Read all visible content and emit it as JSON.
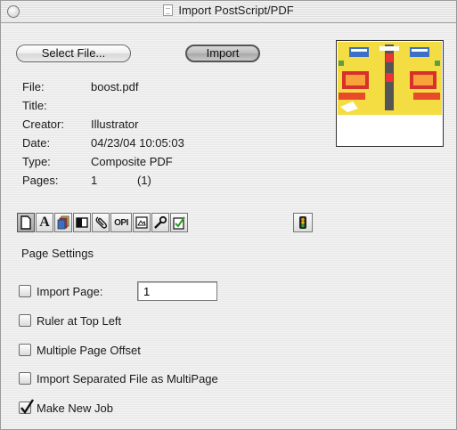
{
  "window": {
    "title": "Import PostScript/PDF"
  },
  "buttons": {
    "select_file": "Select File...",
    "import": "Import"
  },
  "file_info": {
    "rows": [
      {
        "label": "File:",
        "value": "boost.pdf"
      },
      {
        "label": "Title:",
        "value": ""
      },
      {
        "label": "Creator:",
        "value": "Illustrator"
      },
      {
        "label": "Date:",
        "value": "04/23/04 10:05:03"
      },
      {
        "label": "Type:",
        "value": "Composite PDF"
      },
      {
        "label": "Pages:",
        "value": "1",
        "extra": "(1)"
      }
    ]
  },
  "toolbar": {
    "icons": [
      "page-icon",
      "font-icon",
      "color-icon",
      "box-icon",
      "link-icon",
      "opi-icon",
      "image-icon",
      "wrench-icon",
      "check-icon"
    ],
    "opi_text": "OPI",
    "font_text": "A",
    "status_icon": "traffic-light-icon"
  },
  "page_settings": {
    "title": "Page Settings",
    "import_page": {
      "label": "Import Page:",
      "checked": false,
      "value": "1"
    },
    "ruler_top_left": {
      "label": "Ruler at Top Left",
      "checked": false
    },
    "multiple_page_offset": {
      "label": "Multiple Page Offset",
      "checked": false
    },
    "import_separated": {
      "label": "Import Separated File as MultiPage",
      "checked": false
    },
    "make_new_job": {
      "label": "Make New Job",
      "checked": true
    }
  },
  "colors": {
    "window_bg": "#ececec",
    "preview_yellow": "#f2e64a",
    "preview_red": "#d8302a",
    "preview_blue": "#3c6fc8"
  }
}
